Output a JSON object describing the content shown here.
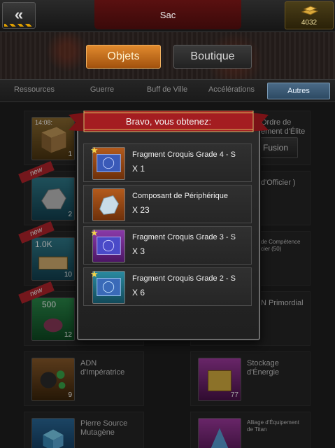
{
  "header": {
    "title": "Sac",
    "back_icon": "double-chevron-left-icon",
    "gold_amount": "4032"
  },
  "main_tabs": [
    {
      "label": "Objets",
      "active": true
    },
    {
      "label": "Boutique",
      "active": false
    }
  ],
  "sub_tabs": [
    {
      "label": "Ressources",
      "active": false
    },
    {
      "label": "Guerre",
      "active": false
    },
    {
      "label": "Buff de Ville",
      "active": false
    },
    {
      "label": "Accélérations",
      "active": false
    },
    {
      "label": "Autres",
      "active": true
    }
  ],
  "grid": {
    "items": [
      {
        "top_text": "14:08:",
        "count": "1",
        "badge": ""
      },
      {
        "top_text": "",
        "count": "2",
        "badge": "new"
      },
      {
        "top_text": "1.0K",
        "count": "10",
        "badge": "new"
      },
      {
        "top_text": "500",
        "count": "12",
        "badge": "new"
      },
      {
        "name": "ADN d'Impératrice",
        "count": "9"
      },
      {
        "name": "Pierre Source Mutagène",
        "count": ""
      }
    ],
    "right_items": [
      {
        "name": "Ordre de ement d'Élite"
      },
      {
        "name": "d'Officier )"
      },
      {
        "name": "de Compétence cier (50)"
      },
      {
        "name": "N Primordial"
      },
      {
        "name": "Stockage d'Énergie",
        "count": "77"
      },
      {
        "name": "Alliage d'Équipement de Titan"
      }
    ],
    "fusion_label": "Fusion"
  },
  "dialog": {
    "title": "Bravo, vous obtenez:",
    "rewards": [
      {
        "name": "Fragment Croquis Grade 4 - S",
        "qty": "X 1",
        "icon": "blueprint-scroll-icon",
        "frame": "orange",
        "star": true
      },
      {
        "name": "Composant de Périphérique",
        "qty": "X 23",
        "icon": "crystal-ore-icon",
        "frame": "orange",
        "star": false
      },
      {
        "name": "Fragment Croquis Grade 3 - S",
        "qty": "X 3",
        "icon": "blueprint-scroll-icon",
        "frame": "purple",
        "star": true
      },
      {
        "name": "Fragment Croquis Grade 2 - S",
        "qty": "X 6",
        "icon": "blueprint-scroll-icon",
        "frame": "teal",
        "star": true
      }
    ]
  },
  "colors": {
    "accent_orange": "#d9802a",
    "ribbon_red": "#a41d21",
    "active_subtab": "#3d5c78"
  }
}
